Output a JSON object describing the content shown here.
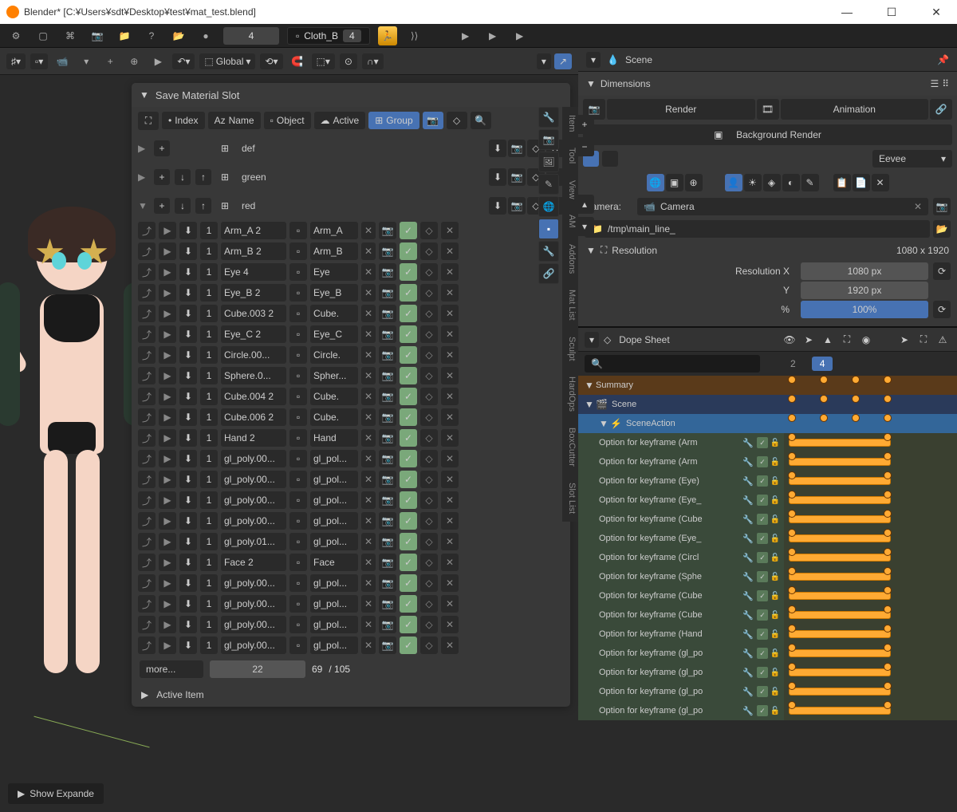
{
  "window": {
    "title": "Blender* [C:¥Users¥sdt¥Desktop¥test¥mat_test.blend]"
  },
  "topmenu": {
    "frame": "4",
    "activeObject": "Cloth_B",
    "activeObjectUsers": "4"
  },
  "toolbar": {
    "orientation": "Global"
  },
  "panel": {
    "title": "Save Material Slot",
    "tabs": {
      "index": "Index",
      "name": "Name",
      "object": "Object",
      "active": "Active",
      "group": "Group"
    },
    "groups": [
      {
        "name": "def",
        "expanded": false,
        "arrows": false
      },
      {
        "name": "green",
        "expanded": false,
        "arrows": true
      },
      {
        "name": "red",
        "expanded": true,
        "arrows": true
      }
    ],
    "rows": [
      {
        "num": "1",
        "obj": "Arm_A 2",
        "mat": "Arm_A"
      },
      {
        "num": "1",
        "obj": "Arm_B 2",
        "mat": "Arm_B"
      },
      {
        "num": "1",
        "obj": "Eye 4",
        "mat": "Eye"
      },
      {
        "num": "1",
        "obj": "Eye_B 2",
        "mat": "Eye_B"
      },
      {
        "num": "1",
        "obj": "Cube.003 2",
        "mat": "Cube."
      },
      {
        "num": "1",
        "obj": "Eye_C 2",
        "mat": "Eye_C"
      },
      {
        "num": "1",
        "obj": "Circle.00...",
        "mat": "Circle."
      },
      {
        "num": "1",
        "obj": "Sphere.0...",
        "mat": "Spher..."
      },
      {
        "num": "1",
        "obj": "Cube.004 2",
        "mat": "Cube."
      },
      {
        "num": "1",
        "obj": "Cube.006 2",
        "mat": "Cube."
      },
      {
        "num": "1",
        "obj": "Hand 2",
        "mat": "Hand"
      },
      {
        "num": "1",
        "obj": "gl_poly.00...",
        "mat": "gl_pol..."
      },
      {
        "num": "1",
        "obj": "gl_poly.00...",
        "mat": "gl_pol..."
      },
      {
        "num": "1",
        "obj": "gl_poly.00...",
        "mat": "gl_pol..."
      },
      {
        "num": "1",
        "obj": "gl_poly.00...",
        "mat": "gl_pol..."
      },
      {
        "num": "1",
        "obj": "gl_poly.01...",
        "mat": "gl_pol..."
      },
      {
        "num": "1",
        "obj": "Face 2",
        "mat": "Face"
      },
      {
        "num": "1",
        "obj": "gl_poly.00...",
        "mat": "gl_pol..."
      },
      {
        "num": "1",
        "obj": "gl_poly.00...",
        "mat": "gl_pol..."
      },
      {
        "num": "1",
        "obj": "gl_poly.00...",
        "mat": "gl_pol..."
      },
      {
        "num": "1",
        "obj": "gl_poly.00...",
        "mat": "gl_pol..."
      }
    ],
    "footer": {
      "more": "more...",
      "current": "22",
      "count": "69",
      "total": "/ 105"
    },
    "activeItem": "Active Item",
    "showExpanded": "Show Expande"
  },
  "vertTabs": [
    "Item",
    "Tool",
    "View",
    "AM",
    "Addons",
    "Mat List",
    "Sculpt",
    "HardOps",
    "BoxCutter",
    "Slot List"
  ],
  "rightHeader": {
    "scene": "Scene"
  },
  "dimensions": {
    "title": "Dimensions",
    "render": "Render",
    "animation": "Animation",
    "bgRender": "Background Render",
    "engine": "Eevee",
    "cameraLabel": "Camera:",
    "cameraName": "Camera",
    "path": "/tmp\\main_line_",
    "resolution": {
      "title": "Resolution",
      "full": "1080 x 1920",
      "xlabel": "Resolution X",
      "xval": "1080 px",
      "ylabel": "Y",
      "yval": "1920 px",
      "pctlabel": "%",
      "pctval": "100%"
    }
  },
  "dope": {
    "title": "Dope Sheet",
    "summary": "Summary",
    "scene": "Scene",
    "action": "SceneAction",
    "timeline": {
      "prev": "2",
      "cur": "4"
    },
    "tracks": [
      "Option for keyframe (Arm",
      "Option for keyframe (Arm",
      "Option for keyframe (Eye)",
      "Option for keyframe (Eye_",
      "Option for keyframe (Cube",
      "Option for keyframe (Eye_",
      "Option for keyframe (Circl",
      "Option for keyframe (Sphe",
      "Option for keyframe (Cube",
      "Option for keyframe (Cube",
      "Option for keyframe (Hand",
      "Option for keyframe (gl_po",
      "Option for keyframe (gl_po",
      "Option for keyframe (gl_po",
      "Option for keyframe (gl_po"
    ]
  }
}
